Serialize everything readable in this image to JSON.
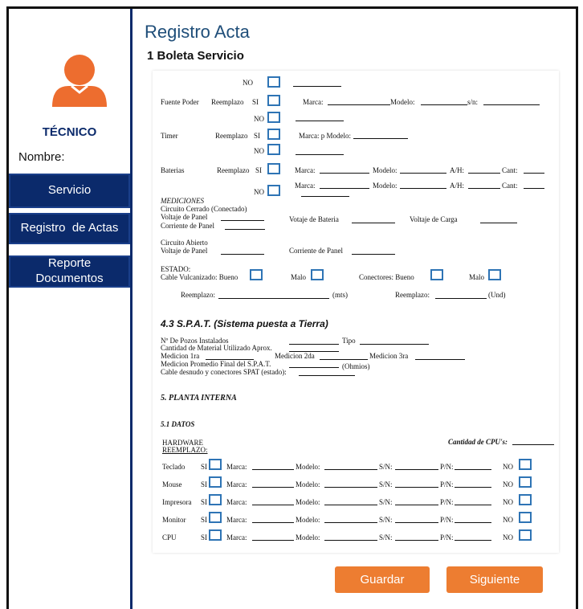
{
  "header": {
    "title": "Registro Acta",
    "section": "1 Boleta Servicio"
  },
  "sidebar": {
    "role": "TÉCNICO",
    "name_label": "Nombre:",
    "avatar_icon": "user-icon",
    "avatar_color": "#ed6d2f",
    "items": [
      {
        "label": "Servicio"
      },
      {
        "label": "Registro  de Actas"
      },
      {
        "label_line1": "Reporte",
        "label_line2": "Documentos"
      }
    ]
  },
  "form": {
    "no": "NO",
    "si": "SI",
    "reemplazo": "Reemplazo",
    "fuente_poder": "Fuente Poder",
    "timer": "Timer",
    "baterias": "Baterias",
    "marca": "Marca:",
    "modelo": "Modelo:",
    "sn": "s/n:",
    "marca_p_modelo": "Marca: p Modelo:",
    "ah": "A/H:",
    "cant": "Cant:",
    "mediciones": "MEDICIONES",
    "circuito_cerrado": "Circuito Cerrado (Conectado)",
    "voltaje_panel": "Voltaje de Panel",
    "corriente_panel": "Corriente de Panel",
    "votaje_bateria": "Votaje de Bateria",
    "voltaje_carga": "Voltaje de Carga",
    "circuito_abierto": "Circuito Abierto",
    "estado": "ESTADO:",
    "cable_vulcanizado": "Cable Vulcanizado: Bueno",
    "malo": "Malo",
    "conectores_bueno": "Conectores: Bueno",
    "reemplazo_colon": "Reemplazo:",
    "mts": "(mts)",
    "und": "(Und)",
    "spat_title": "4.3  S.P.A.T. (Sistema puesta a Tierra)",
    "pozos": "Nº De Pozos Instalados",
    "tipo": "Tipo",
    "cantidad_material": "Cantidad de Material Utilizado Aprox.",
    "medicion_1ra": "Medicion 1ra",
    "medicion_2da": "Medicion 2da",
    "medicion_3ra": "Medicion 3ra",
    "medicion_promedio": "Medicion Promedio Final del S.P.A.T.",
    "ohmios": "(Ohmios)",
    "cable_desnudo": "Cable desnudo y conectores SPAT (estado):",
    "planta_title": "5.  PLANTA INTERNA",
    "datos_title": "5.1  DATOS",
    "hardware": "HARDWARE",
    "reemplazo_upper": "REEMPLAZO:",
    "cantidad_cpus": "Cantidad de CPU's:",
    "sn_upper": "S/N:",
    "pn": "P/N:",
    "hw_items": [
      "Teclado",
      "Mouse",
      "Impresora",
      "Monitor",
      "CPU"
    ]
  },
  "actions": {
    "save": "Guardar",
    "next": "Siguiente"
  },
  "colors": {
    "navy": "#0b2a6b",
    "orange": "#ed7d31",
    "checkbox_border": "#2e74b5"
  }
}
